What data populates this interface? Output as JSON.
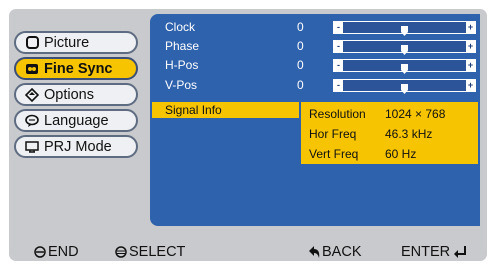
{
  "menu": {
    "items": [
      {
        "label": "Picture",
        "icon": "picture-icon",
        "active": false
      },
      {
        "label": "Fine Sync",
        "icon": "fine-sync-icon",
        "active": true
      },
      {
        "label": "Options",
        "icon": "options-icon",
        "active": false
      },
      {
        "label": "Language",
        "icon": "language-icon",
        "active": false
      },
      {
        "label": "PRJ Mode",
        "icon": "prj-mode-icon",
        "active": false
      }
    ]
  },
  "adjustments": [
    {
      "label": "Clock",
      "value": "0",
      "level": 0.5
    },
    {
      "label": "Phase",
      "value": "0",
      "level": 0.5
    },
    {
      "label": "H-Pos",
      "value": "0",
      "level": 0.5
    },
    {
      "label": "V-Pos",
      "value": "0",
      "level": 0.5
    }
  ],
  "signal_info": {
    "label": "Signal Info",
    "rows": [
      {
        "key": "Resolution",
        "value": "1024 × 768"
      },
      {
        "key": "Hor Freq",
        "value": "46.3 kHz"
      },
      {
        "key": "Vert Freq",
        "value": "60 Hz"
      }
    ]
  },
  "slider_caps": {
    "minus": "-",
    "plus": "+"
  },
  "footer": {
    "end": "END",
    "select": "SELECT",
    "back": "BACK",
    "enter": "ENTER"
  },
  "colors": {
    "panel": "#2f62ad",
    "highlight": "#f6c400",
    "background": "#c9cacd"
  }
}
